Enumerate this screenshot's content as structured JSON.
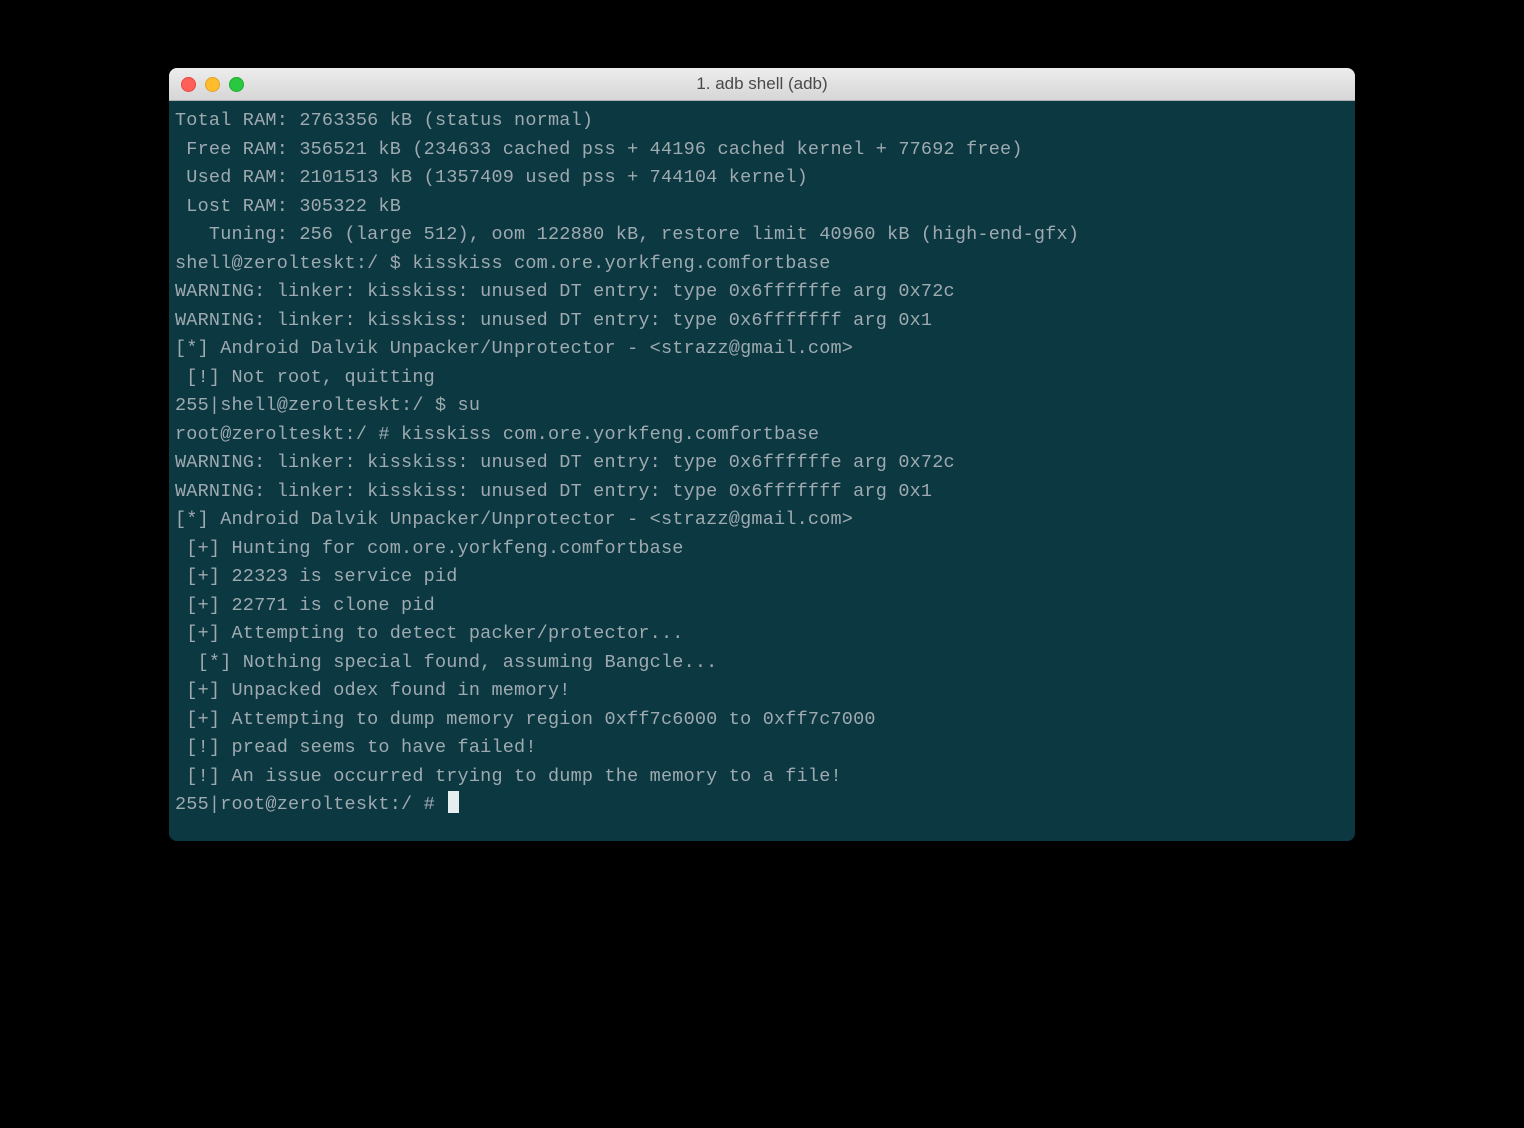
{
  "window": {
    "title": "1. adb shell (adb)"
  },
  "traffic_lights": {
    "close": "close-button",
    "minimize": "minimize-button",
    "zoom": "zoom-button"
  },
  "terminal": {
    "lines": [
      "Total RAM: 2763356 kB (status normal)",
      " Free RAM: 356521 kB (234633 cached pss + 44196 cached kernel + 77692 free)",
      " Used RAM: 2101513 kB (1357409 used pss + 744104 kernel)",
      " Lost RAM: 305322 kB",
      "   Tuning: 256 (large 512), oom 122880 kB, restore limit 40960 kB (high-end-gfx)",
      "shell@zerolteskt:/ $ kisskiss com.ore.yorkfeng.comfortbase",
      "WARNING: linker: kisskiss: unused DT entry: type 0x6ffffffe arg 0x72c",
      "WARNING: linker: kisskiss: unused DT entry: type 0x6fffffff arg 0x1",
      "[*] Android Dalvik Unpacker/Unprotector - <strazz@gmail.com>",
      " [!] Not root, quitting",
      "255|shell@zerolteskt:/ $ su",
      "root@zerolteskt:/ # kisskiss com.ore.yorkfeng.comfortbase",
      "WARNING: linker: kisskiss: unused DT entry: type 0x6ffffffe arg 0x72c",
      "WARNING: linker: kisskiss: unused DT entry: type 0x6fffffff arg 0x1",
      "[*] Android Dalvik Unpacker/Unprotector - <strazz@gmail.com>",
      " [+] Hunting for com.ore.yorkfeng.comfortbase",
      " [+] 22323 is service pid",
      " [+] 22771 is clone pid",
      " [+] Attempting to detect packer/protector...",
      "  [*] Nothing special found, assuming Bangcle...",
      " [+] Unpacked odex found in memory!",
      " [+] Attempting to dump memory region 0xff7c6000 to 0xff7c7000",
      " [!] pread seems to have failed!",
      " [!] An issue occurred trying to dump the memory to a file!"
    ],
    "prompt": "255|root@zerolteskt:/ #"
  }
}
